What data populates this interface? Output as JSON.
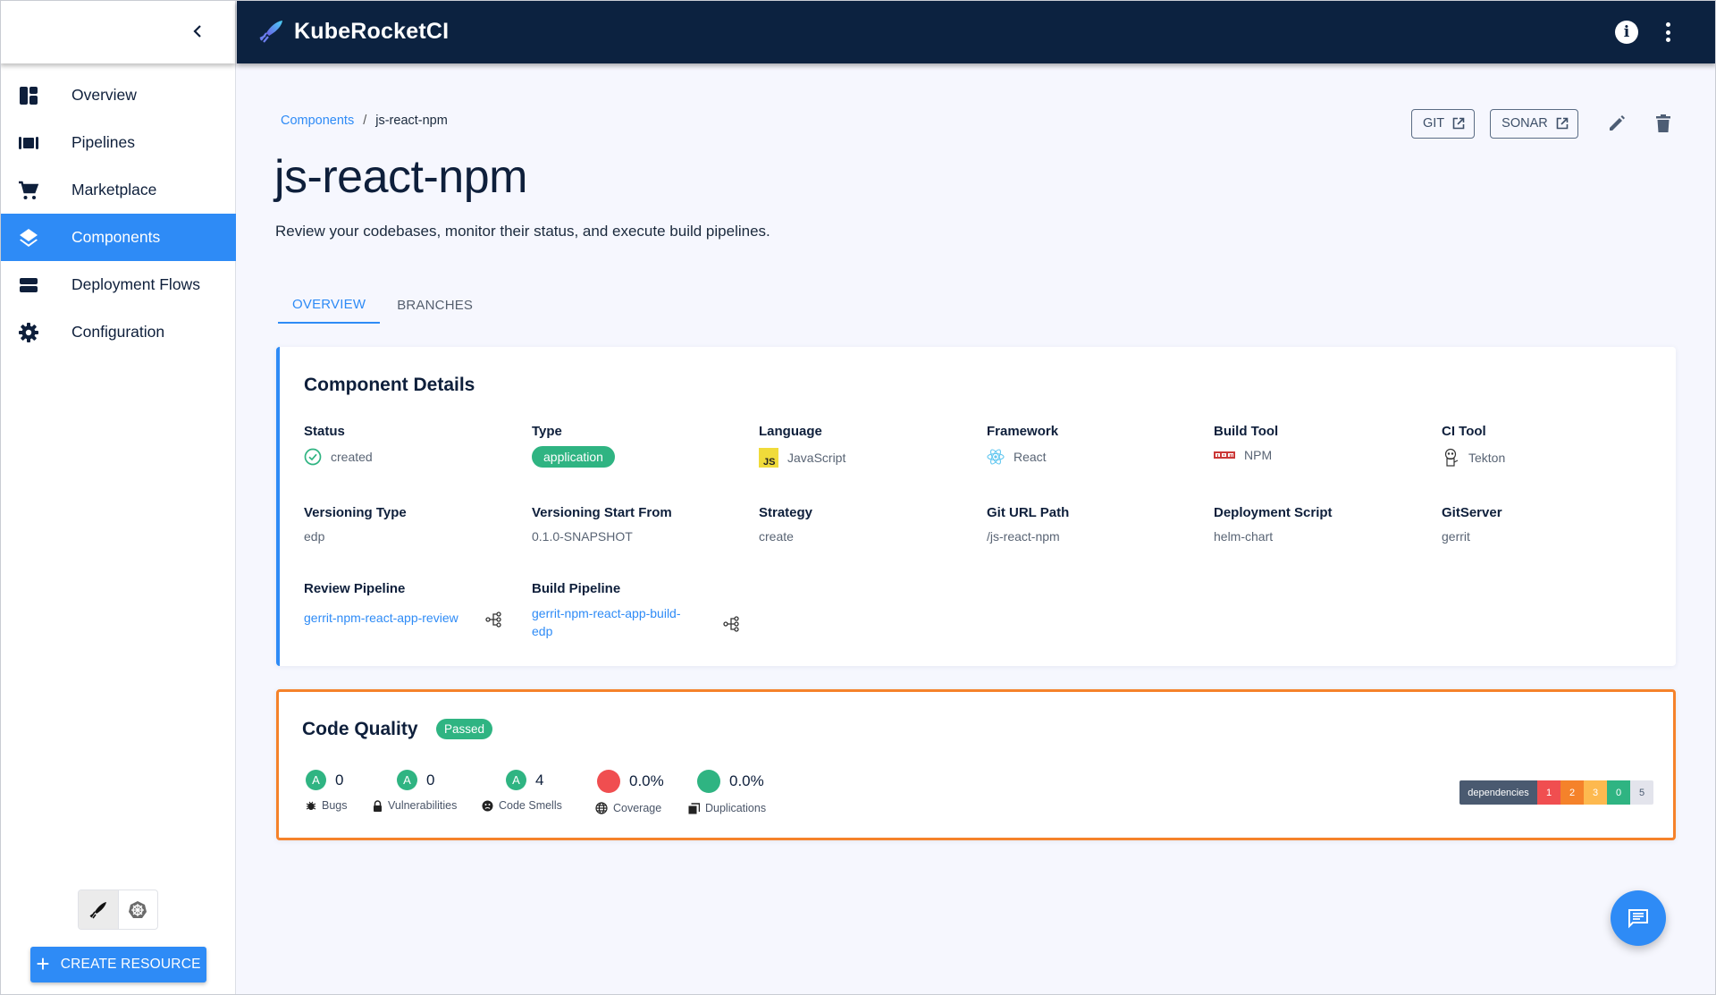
{
  "app": {
    "title": "KubeRocketCI"
  },
  "sidebar": {
    "collapse_icon": "chevron-left-icon",
    "items": [
      {
        "label": "Overview",
        "icon": "dashboard-icon",
        "active": false
      },
      {
        "label": "Pipelines",
        "icon": "pipelines-icon",
        "active": false
      },
      {
        "label": "Marketplace",
        "icon": "cart-icon",
        "active": false
      },
      {
        "label": "Components",
        "icon": "layers-icon",
        "active": true
      },
      {
        "label": "Deployment Flows",
        "icon": "stack-icon",
        "active": false
      },
      {
        "label": "Configuration",
        "icon": "gear-icon",
        "active": false
      }
    ],
    "mode_toggle": [
      {
        "icon": "kuberocketci-icon",
        "active": true
      },
      {
        "icon": "kubernetes-icon",
        "active": false
      }
    ],
    "create_button": "CREATE RESOURCE"
  },
  "header": {
    "info_icon": "info-icon",
    "more_icon": "more-vert-icon"
  },
  "breadcrumb": {
    "parent": "Components",
    "separator": "/",
    "current": "js-react-npm"
  },
  "page": {
    "title": "js-react-npm",
    "description": "Review your codebases, monitor their status, and execute build pipelines."
  },
  "actions": {
    "git": "GIT",
    "sonar": "SONAR"
  },
  "tabs": [
    {
      "label": "OVERVIEW",
      "active": true
    },
    {
      "label": "BRANCHES",
      "active": false
    }
  ],
  "details": {
    "title": "Component Details",
    "fields": {
      "status": {
        "label": "Status",
        "value": "created"
      },
      "type": {
        "label": "Type",
        "value": "application"
      },
      "language": {
        "label": "Language",
        "value": "JavaScript"
      },
      "framework": {
        "label": "Framework",
        "value": "React"
      },
      "build_tool": {
        "label": "Build Tool",
        "value": "NPM"
      },
      "ci_tool": {
        "label": "CI Tool",
        "value": "Tekton"
      },
      "versioning_type": {
        "label": "Versioning Type",
        "value": "edp"
      },
      "versioning_start": {
        "label": "Versioning Start From",
        "value": "0.1.0-SNAPSHOT"
      },
      "strategy": {
        "label": "Strategy",
        "value": "create"
      },
      "git_url": {
        "label": "Git URL Path",
        "value": "/js-react-npm"
      },
      "deploy_script": {
        "label": "Deployment Script",
        "value": "helm-chart"
      },
      "git_server": {
        "label": "GitServer",
        "value": "gerrit"
      },
      "review_pipeline": {
        "label": "Review Pipeline",
        "value": "gerrit-npm-react-app-review"
      },
      "build_pipeline": {
        "label": "Build Pipeline",
        "value_line1": "gerrit-npm-react-app-build-",
        "value_line2": "edp"
      }
    }
  },
  "quality": {
    "title": "Code Quality",
    "status": "Passed",
    "metrics": [
      {
        "grade": "A",
        "value": "0",
        "label": "Bugs",
        "icon": "bug-icon"
      },
      {
        "grade": "A",
        "value": "0",
        "label": "Vulnerabilities",
        "icon": "lock-icon"
      },
      {
        "grade": "A",
        "value": "4",
        "label": "Code Smells",
        "icon": "sad-face-icon"
      },
      {
        "dot_color": "#f04e50",
        "value": "0.0%",
        "label": "Coverage",
        "icon": "globe-icon"
      },
      {
        "dot_color": "#2fb482",
        "value": "0.0%",
        "label": "Duplications",
        "icon": "copy-icon"
      }
    ],
    "dependencies": {
      "label": "dependencies",
      "counts": [
        {
          "value": "1",
          "color": "#f04e50"
        },
        {
          "value": "2",
          "color": "#f5822a"
        },
        {
          "value": "3",
          "color": "#fdb94f"
        },
        {
          "value": "0",
          "color": "#2fb482"
        },
        {
          "value": "5",
          "color": "#e3e4ec"
        }
      ]
    }
  },
  "colors": {
    "accent": "#2e8bf6",
    "header": "#0c2240",
    "success": "#2fb482",
    "highlight_border": "#f5822a"
  }
}
